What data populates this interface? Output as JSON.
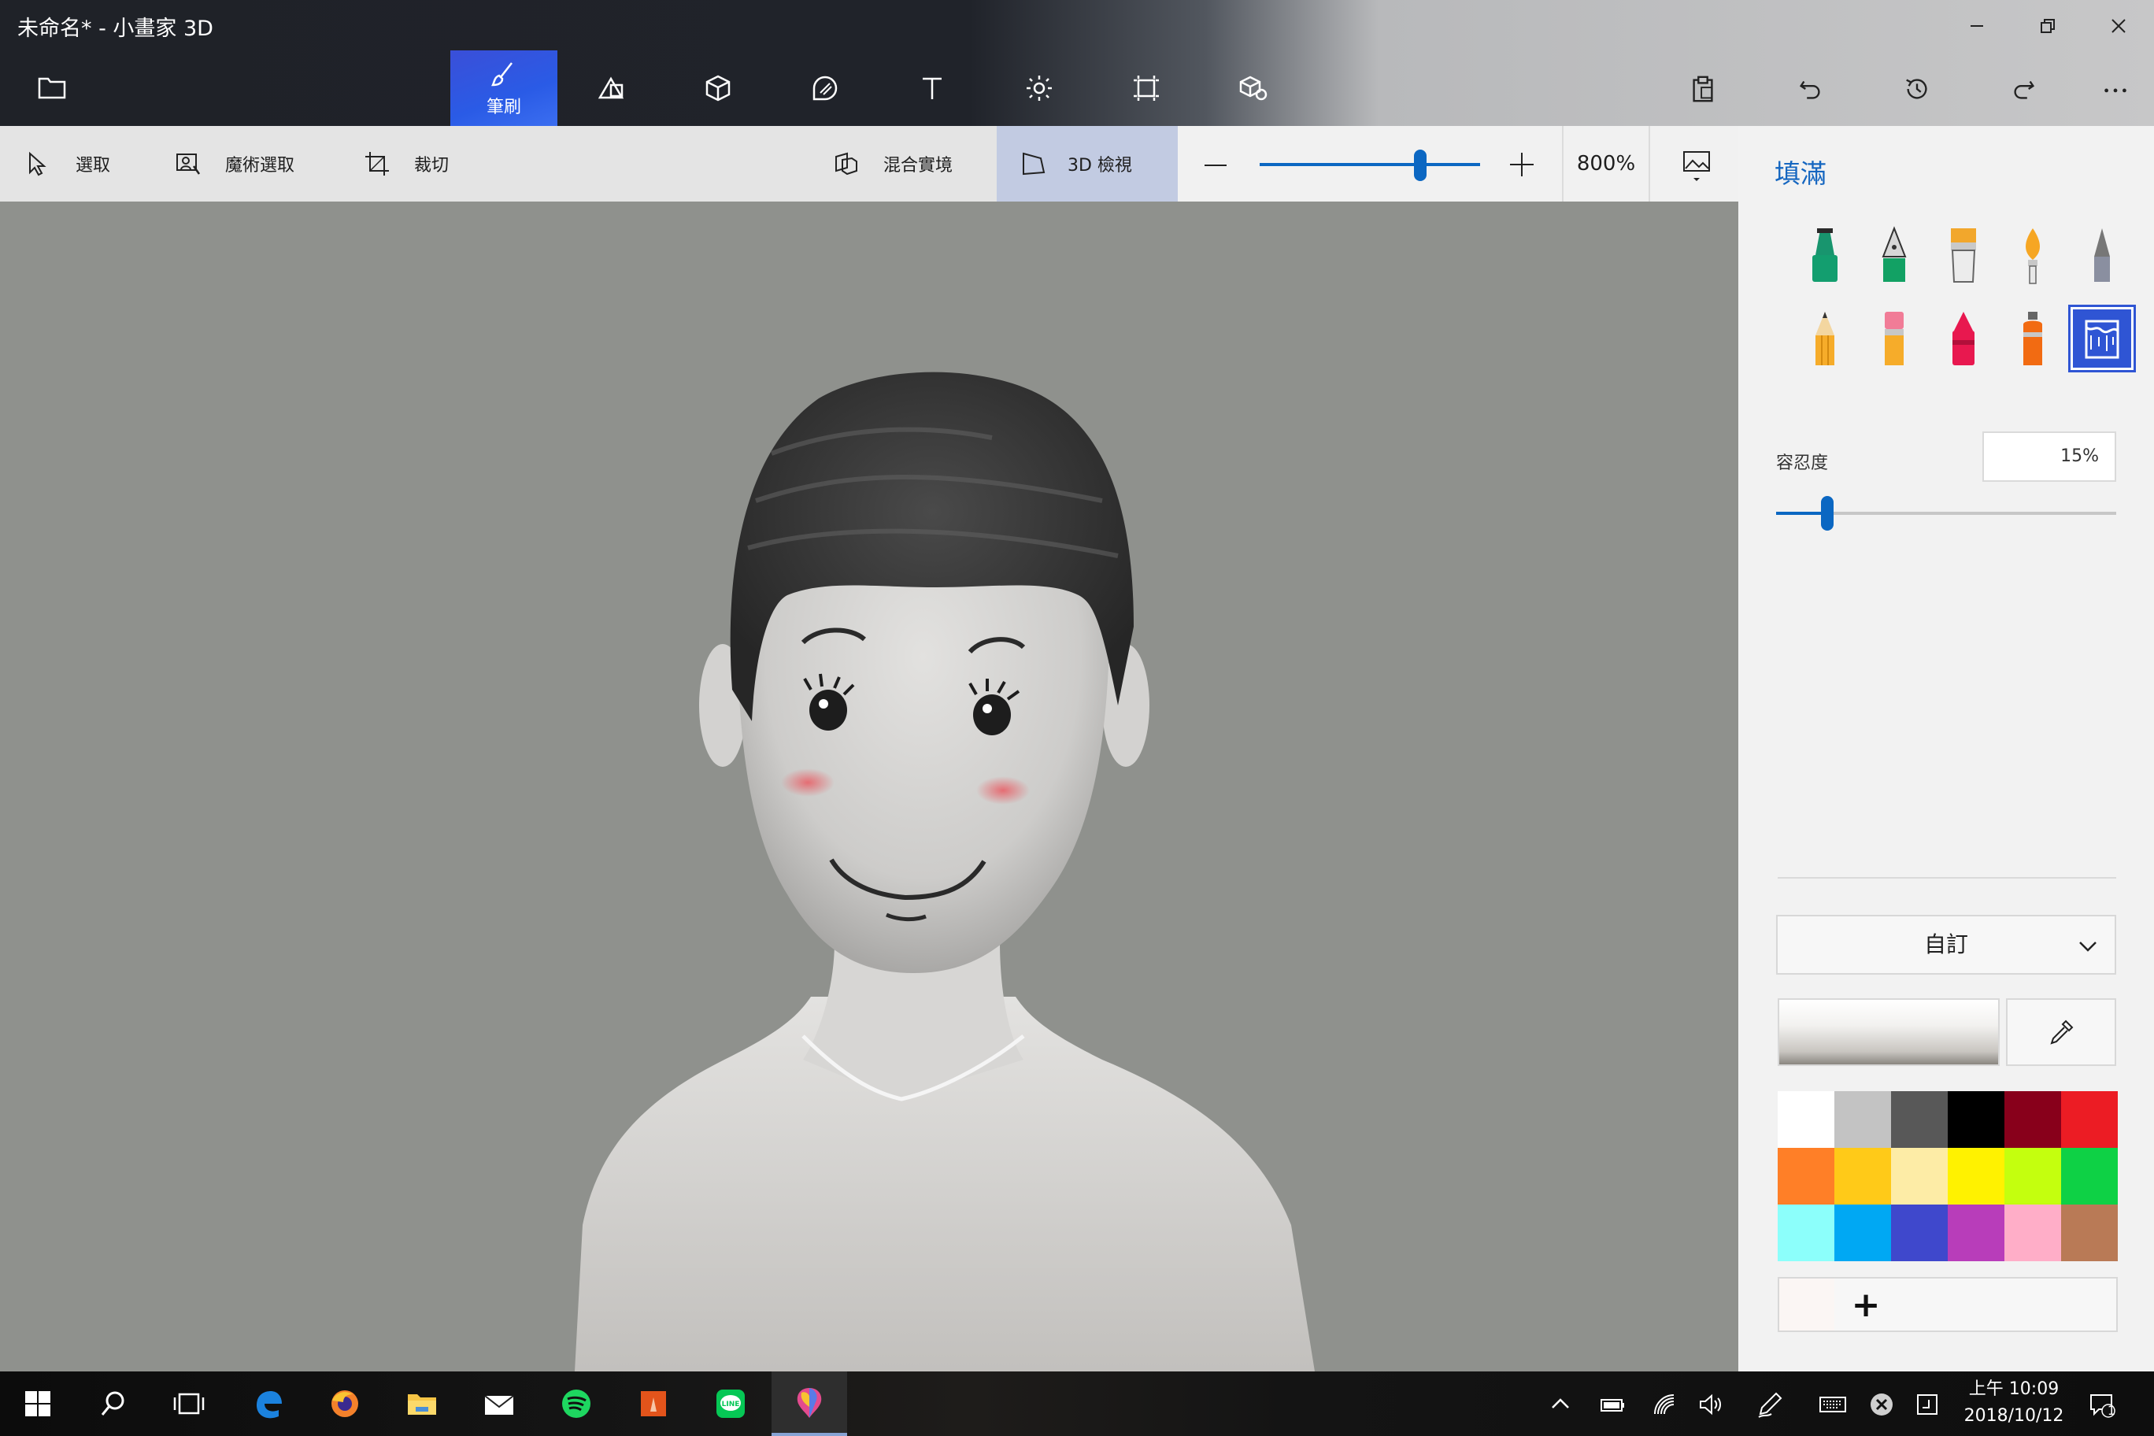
{
  "window": {
    "title": "未命名* - 小畫家 3D"
  },
  "toolbar": {
    "active_tool_label": "筆刷",
    "tools": [
      "brushes",
      "2d-shapes",
      "3d-shapes",
      "stickers",
      "text",
      "effects",
      "canvas",
      "3d-library"
    ]
  },
  "subtoolbar": {
    "select_label": "選取",
    "magic_select_label": "魔術選取",
    "crop_label": "裁切",
    "mixed_reality_label": "混合實境",
    "view3d_label": "3D 檢視",
    "zoom_value": "800%",
    "zoom_level": 0.73
  },
  "panel": {
    "title": "填滿",
    "tolerance_label": "容忍度",
    "tolerance_value": "15%",
    "tolerance_level": 0.15,
    "dropdown_value": "自訂",
    "add_color_label": "+",
    "palette": [
      "#ffffff",
      "#c3c3c3",
      "#585858",
      "#000000",
      "#88001b",
      "#ec1c24",
      "#ff7f27",
      "#ffca18",
      "#fdeca6",
      "#fff200",
      "#c4ff0e",
      "#0ed145",
      "#8cfffb",
      "#00a8f3",
      "#3f48cc",
      "#b83dba",
      "#ffaec8",
      "#b97a56"
    ],
    "selected_brush": "fill-icon"
  },
  "taskbar": {
    "time": "上午 10:09",
    "date": "2018/10/12",
    "notification_count": "1"
  },
  "colors": {
    "accent": "#0b67c2",
    "active_tool": "#2a5be6",
    "canvas_bg": "#8f918d"
  }
}
